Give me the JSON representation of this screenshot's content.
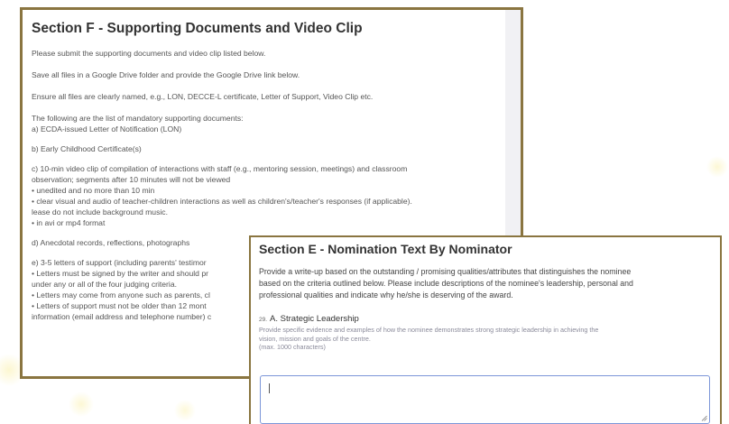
{
  "section_f": {
    "title": "Section F - Supporting Documents and Video Clip",
    "lines": [
      "Please submit the supporting documents and video clip listed below.",
      "Save all files in a Google Drive folder and provide the Google Drive link below.",
      "Ensure all files are clearly named, e.g., LON, DECCE-L certificate, Letter of Support, Video Clip etc.",
      "The following are the list of mandatory supporting documents:",
      "a) ECDA-issued Letter of Notification (LON)",
      "b) Early Childhood Certificate(s)",
      "c) 10-min video clip of compilation of interactions with staff (e.g., mentoring session, meetings) and classroom",
      "observation; segments after 10 minutes will not be viewed",
      "• unedited and no more than 10 min",
      "• clear visual and audio of teacher-children interactions as well as children's/teacher's responses (if applicable).",
      "lease do not include background music.",
      "• in avi or mp4 format",
      "d) Anecdotal records, reflections, photographs",
      "e) 3-5 letters of support (including parents' testimor",
      "• Letters must be signed by the writer and should pr",
      "under any or all of the four judging criteria.",
      "• Letters may come from anyone such as parents, cl",
      "• Letters of support must not be older than 12 mont",
      "information (email address and telephone number) c"
    ]
  },
  "section_e": {
    "title": "Section E - Nomination Text By Nominator",
    "intro_lines": [
      "Provide a write-up based on the outstanding / promising qualities/attributes that distinguishes the nominee",
      "based on the criteria outlined below. Please include descriptions of the nominee's leadership, personal and",
      "professional qualities and indicate why he/she is deserving of the award."
    ],
    "question": {
      "number": "29.",
      "title": "A. Strategic Leadership",
      "help_lines": [
        "Provide specific  evidence and  examples of how the nominee demonstrates strong strategic leadership in achieving the",
        "vision, mission and goals of the centre."
      ],
      "limit": "(max. 1000 characters)",
      "answer_value": ""
    }
  },
  "colors": {
    "card_border": "#8a7540",
    "input_border": "#7c96d8",
    "heading_text": "#333333",
    "help_text": "#8a8a9a"
  }
}
